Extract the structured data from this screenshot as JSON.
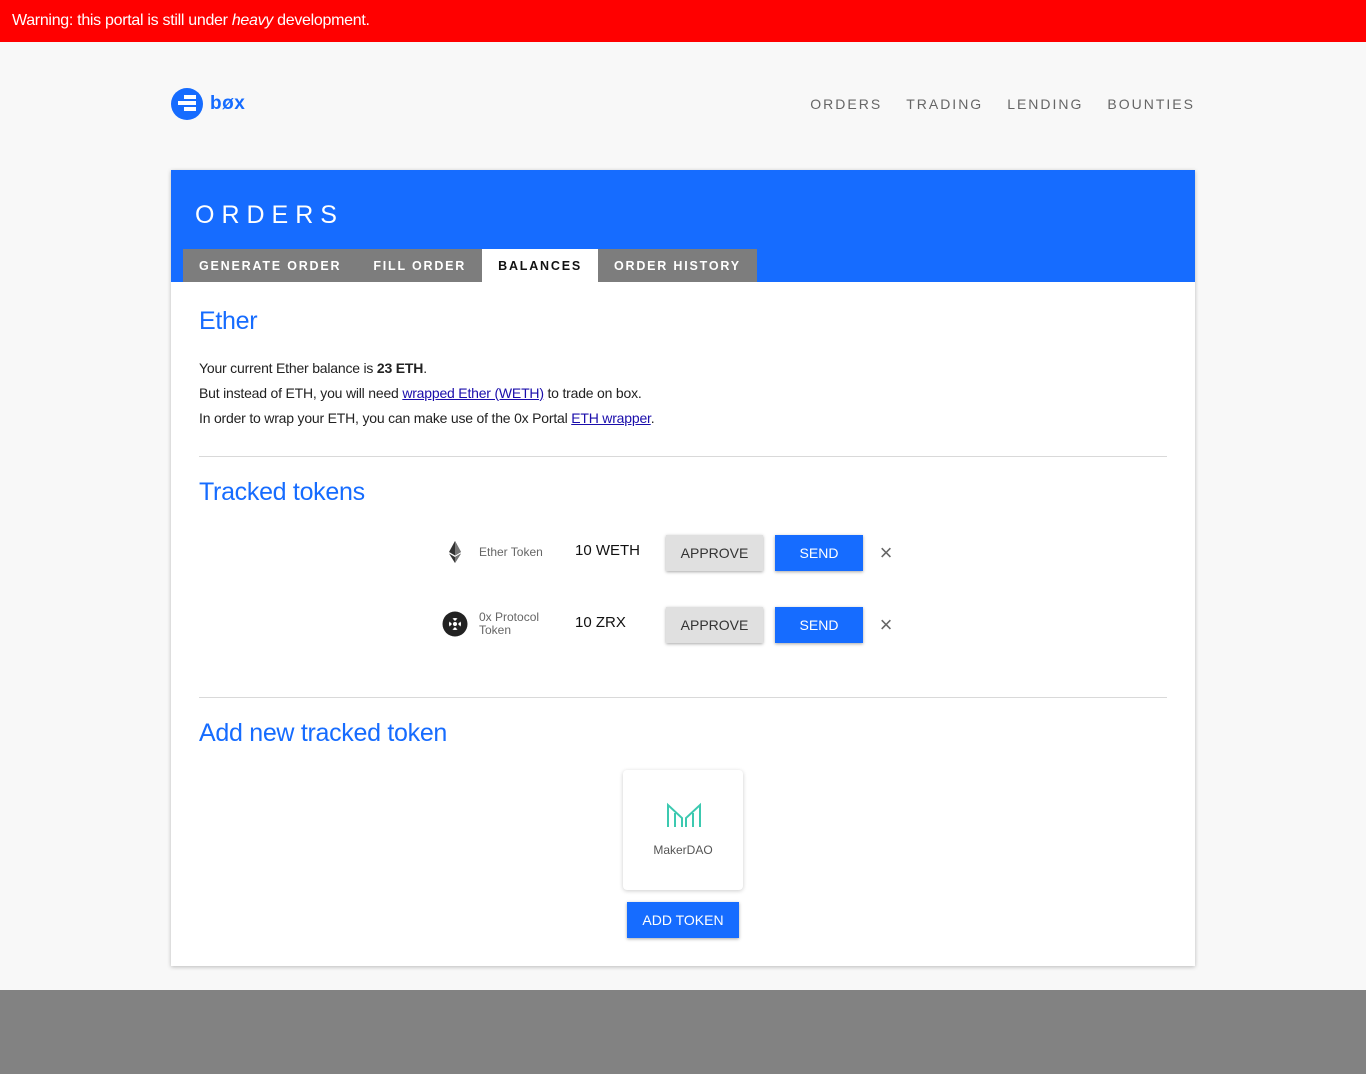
{
  "warning": {
    "prefix": "Warning: this portal is still under ",
    "emphasis": "heavy",
    "suffix": " development."
  },
  "brand": {
    "name": "bøx",
    "color": "#166cff"
  },
  "nav": {
    "items": [
      "ORDERS",
      "TRADING",
      "LENDING",
      "BOUNTIES"
    ]
  },
  "page": {
    "title": "ORDERS",
    "tabs": [
      {
        "label": "GENERATE ORDER",
        "active": false
      },
      {
        "label": "FILL ORDER",
        "active": false
      },
      {
        "label": "BALANCES",
        "active": true
      },
      {
        "label": "ORDER HISTORY",
        "active": false
      }
    ]
  },
  "ether": {
    "title": "Ether",
    "line1_prefix": "Your current Ether balance is ",
    "line1_balance": "23 ETH",
    "line1_suffix": ".",
    "line2_prefix": "But instead of ETH, you will need ",
    "line2_link": "wrapped Ether (WETH)",
    "line2_suffix": " to trade on box.",
    "line3_prefix": "In order to wrap your ETH, you can make use of the 0x Portal ",
    "line3_link": "ETH wrapper",
    "line3_suffix": "."
  },
  "tracked": {
    "title": "Tracked tokens",
    "tokens": [
      {
        "icon": "ethereum-icon",
        "name": "Ether Token",
        "balance": "10 WETH",
        "approve_label": "APPROVE",
        "send_label": "SEND",
        "remove_icon": "×"
      },
      {
        "icon": "zrx-icon",
        "name": "0x Protocol Token",
        "balance": "10 ZRX",
        "approve_label": "APPROVE",
        "send_label": "SEND",
        "remove_icon": "×"
      }
    ]
  },
  "add_token": {
    "title": "Add new tracked token",
    "candidate": {
      "icon": "makerdao-icon",
      "name": "MakerDAO"
    },
    "button_label": "ADD TOKEN"
  },
  "colors": {
    "warning": "#ff0000",
    "accent": "#166cff",
    "tab_inactive": "#7d7d7d",
    "footer": "#828282"
  }
}
